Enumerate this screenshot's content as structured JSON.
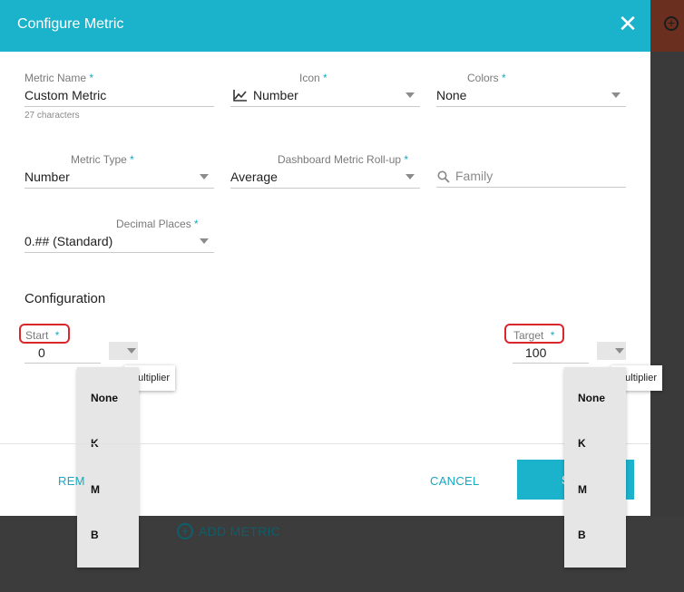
{
  "dialog": {
    "title": "Configure Metric",
    "close_glyph": "✕"
  },
  "form": {
    "metric_name": {
      "label": "Metric Name",
      "required": "*",
      "value": "Custom Metric",
      "helper": "27 characters"
    },
    "icon": {
      "label": "Icon",
      "required": "*",
      "value": "Number",
      "icon_name": "line-chart-icon"
    },
    "colors": {
      "label": "Colors",
      "required": "*",
      "value": "None"
    },
    "metric_type": {
      "label": "Metric Type",
      "required": "*",
      "value": "Number"
    },
    "rollup": {
      "label": "Dashboard Metric Roll-up",
      "required": "*",
      "value": "Average"
    },
    "family": {
      "placeholder": "Family",
      "icon_name": "search-icon"
    },
    "decimal_places": {
      "label": "Decimal Places",
      "required": "*",
      "value": "0.## (Standard)"
    }
  },
  "configuration": {
    "title": "Configuration",
    "start": {
      "label": "Start",
      "required": "*",
      "value": "0"
    },
    "target": {
      "label": "Target",
      "required": "*",
      "value": "100"
    },
    "multiplier_tooltip": "Multiplier",
    "multiplier_options": [
      "None",
      "K",
      "M",
      "B"
    ]
  },
  "footer": {
    "remove_label_visible": "REM",
    "cancel_label": "CANCEL",
    "save_label_visible": "S"
  },
  "background": {
    "add_metric_label": "ADD METRIC"
  },
  "colors": {
    "accent": "#1bb3cc",
    "highlight": "#d9272e",
    "overlay": "#3c3c3c"
  }
}
